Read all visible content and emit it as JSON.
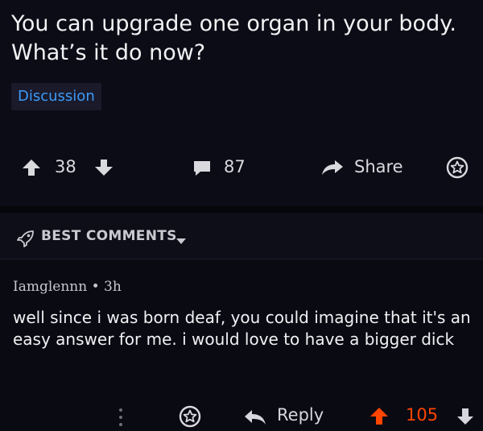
{
  "post": {
    "title": "You can upgrade one organ in your body. What’s it do now?",
    "flair": "Discussion",
    "score": "38",
    "comment_count": "87",
    "share_label": "Share"
  },
  "sort": {
    "label": "BEST COMMENTS"
  },
  "comment": {
    "meta": "Iamglennn • 3h",
    "body": "well since i was born deaf, you could imagine that it's an easy answer for me. i would love to have a bigger dick",
    "reply_label": "Reply",
    "score": "105"
  },
  "colors": {
    "background": "#0b0b14",
    "flair_text": "#3d9af7",
    "upvoted": "#ff4500",
    "text": "#e6e6ea"
  },
  "icons": [
    "upvote-icon",
    "downvote-icon",
    "comment-icon",
    "share-icon",
    "award-icon",
    "rocket-icon",
    "chevron-down-icon",
    "more-icon",
    "reply-icon"
  ]
}
